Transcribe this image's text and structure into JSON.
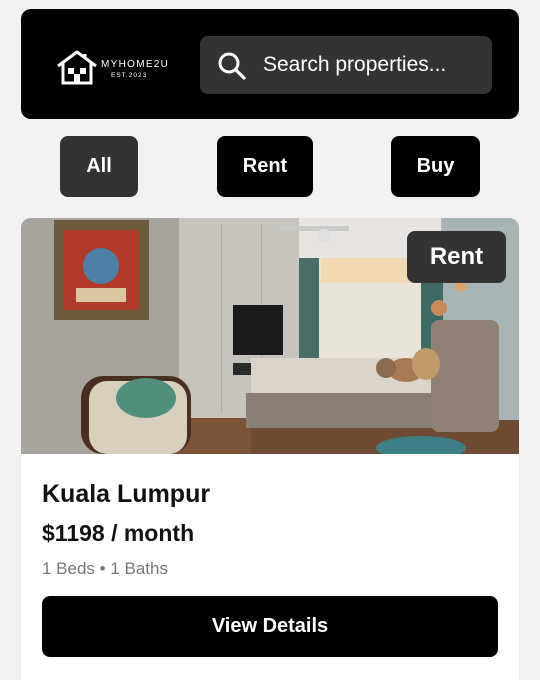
{
  "header": {
    "logo_name": "MYHOME2U",
    "logo_est": "EST.2023",
    "search_placeholder": "Search properties...",
    "search_icon": "search-icon"
  },
  "filters": [
    {
      "label": "All",
      "active": true
    },
    {
      "label": "Rent",
      "active": false
    },
    {
      "label": "Buy",
      "active": false
    }
  ],
  "listing": {
    "badge": "Rent",
    "title": "Kuala Lumpur",
    "price": "$1198 / month",
    "specs": "1 Beds • 1 Baths",
    "button_label": "View Details"
  },
  "colors": {
    "background": "#f2f2f2",
    "header": "#000000",
    "active_filter": "#333333",
    "button": "#000000"
  }
}
